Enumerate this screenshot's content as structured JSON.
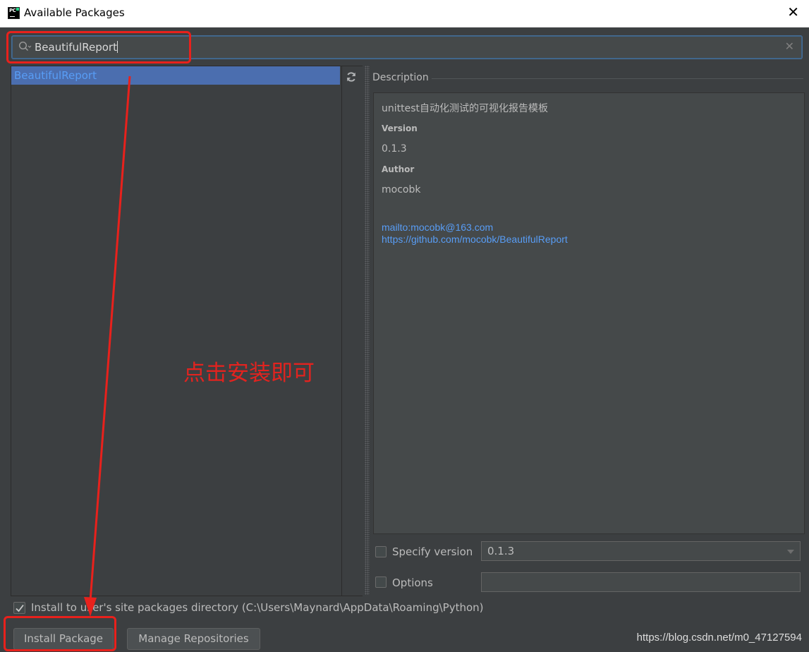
{
  "window": {
    "title": "Available Packages",
    "app_icon_text": "PC"
  },
  "search": {
    "value": "BeautifulReport"
  },
  "packages": [
    {
      "name": "BeautifulReport",
      "selected": true
    }
  ],
  "description": {
    "label": "Description",
    "summary": "unittest自动化测试的可视化报告模板",
    "version_label": "Version",
    "version": "0.1.3",
    "author_label": "Author",
    "author": "mocobk",
    "links": [
      "mailto:mocobk@163.com",
      "https://github.com/mocobk/BeautifulReport"
    ]
  },
  "options": {
    "specify_version_label": "Specify version",
    "specify_version_checked": false,
    "version_value": "0.1.3",
    "options_label": "Options",
    "options_checked": false,
    "options_value": ""
  },
  "install_site": {
    "label": "Install to user's site packages directory (C:\\Users\\Maynard\\AppData\\Roaming\\Python)",
    "checked": true
  },
  "buttons": {
    "install": "Install Package",
    "manage": "Manage Repositories"
  },
  "annotation": {
    "text": "点击安装即可",
    "color": "#e2231f"
  },
  "watermark": "https://blog.csdn.net/m0_47127594",
  "colors": {
    "background": "#3c3f41",
    "selection": "#4b6eaf",
    "link": "#589df6",
    "annotation": "#e8211c"
  }
}
